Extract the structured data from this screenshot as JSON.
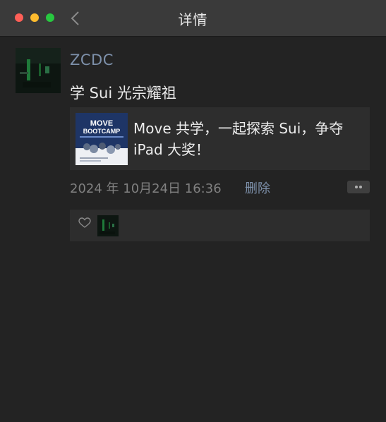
{
  "window": {
    "title": "详情",
    "controls": [
      "close",
      "minimize",
      "maximize"
    ],
    "back_icon": "chevron-left-icon"
  },
  "post": {
    "author": "ZCDC",
    "text": "学 Sui 光宗耀祖",
    "link_card": {
      "title": "Move 共学，一起探索 Sui，争夺 iPad 大奖！",
      "thumbnail_text_line1": "MOVE",
      "thumbnail_text_line2": "BOOTCAMP"
    },
    "timestamp": "2024 年 10月24日 16:36",
    "delete_label": "删除",
    "more_icon": "more-dots-icon"
  },
  "likes": {
    "icon": "heart-icon",
    "count": 1
  },
  "colors": {
    "background": "#232323",
    "titlebar": "#3a3a3a",
    "card": "#2d2d2d",
    "link_blue": "#7d90aa",
    "close": "#fe5f57",
    "minimize": "#febc2e",
    "maximize": "#28c840"
  }
}
